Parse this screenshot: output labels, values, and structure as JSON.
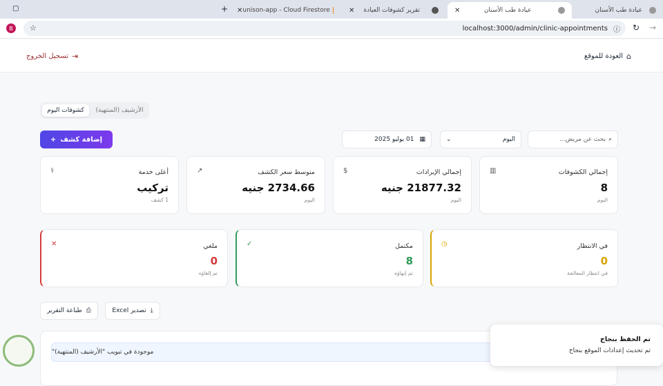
{
  "browser": {
    "tabs": [
      {
        "title": "عيادة طب الأسنان"
      },
      {
        "title": "عيادة طب الأسنان"
      },
      {
        "title": "تقرير كشوفات العيادة"
      },
      {
        "title": "unison-app - Cloud Firestore"
      }
    ],
    "url": "localhost:3000/admin/clinic-appointments",
    "profile_initial": "B"
  },
  "header": {
    "back_label": "العودة للموقع",
    "logout_label": "تسجيل الخروج"
  },
  "segment": {
    "today_label": "كشوفات اليوم",
    "archive_label": "الأرشيف (المنتهية)"
  },
  "filters": {
    "search_placeholder": "بحث عن مريض...",
    "period_value": "اليوم",
    "date_value": "01 يوليو 2025"
  },
  "add_button_label": "إضافة كشف",
  "stats": [
    {
      "label": "إجمالي الكشوفات",
      "value": "8",
      "sub": "اليوم"
    },
    {
      "label": "إجمالي الإيرادات",
      "value": "21877.32 جنيه",
      "sub": "اليوم"
    },
    {
      "label": "متوسط سعر الكشف",
      "value": "2734.66 جنيه",
      "sub": "اليوم"
    },
    {
      "label": "أعلى خدمة",
      "value": "تركيب",
      "sub": "1 كشف"
    }
  ],
  "status": [
    {
      "label": "في الانتظار",
      "value": "0",
      "sub": "في انتظار المعالجة",
      "color": "#d9a400"
    },
    {
      "label": "مكتمل",
      "value": "8",
      "sub": "تم إنهاؤه",
      "color": "#2e9b58"
    },
    {
      "label": "ملغي",
      "value": "0",
      "sub": "تم إلغاؤه",
      "color": "#d33a3a"
    }
  ],
  "actions": {
    "export_label": "تصدير Excel",
    "print_label": "طباعة التقرير"
  },
  "note_text": "موجودة في تبويب \"الأرشيف (المنتهية)\"",
  "toast": {
    "title": "تم الحفظ بنجاح",
    "message": "تم تحديث إعدادات الموقع بنجاح"
  }
}
